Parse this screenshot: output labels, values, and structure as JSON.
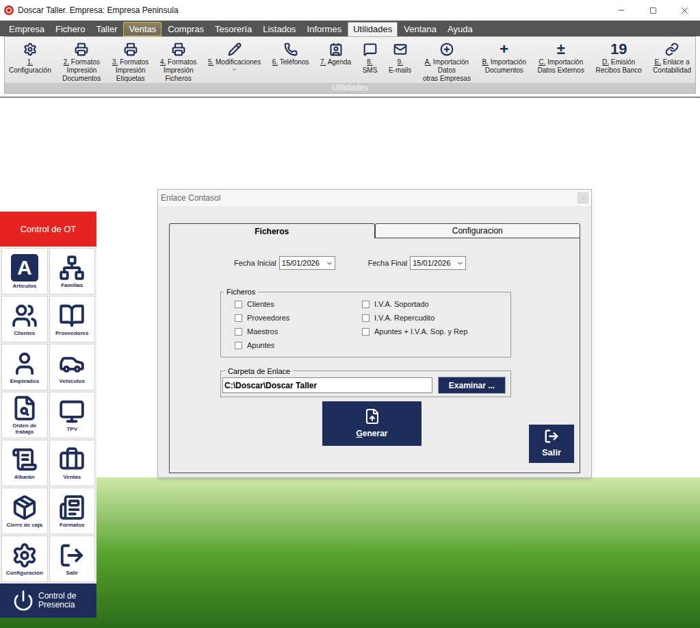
{
  "window": {
    "title": "Doscar Taller. Empresa: Empresa Peninsula"
  },
  "menu": [
    {
      "label": "Empresa",
      "selected": false,
      "highlighted": false
    },
    {
      "label": "Fichero",
      "selected": false,
      "highlighted": false
    },
    {
      "label": "Taller",
      "selected": false,
      "highlighted": false
    },
    {
      "label": "Ventas",
      "selected": false,
      "highlighted": true
    },
    {
      "label": "Compras",
      "selected": false,
      "highlighted": false
    },
    {
      "label": "Tesorería",
      "selected": false,
      "highlighted": false
    },
    {
      "label": "Listados",
      "selected": false,
      "highlighted": false
    },
    {
      "label": "Informes",
      "selected": false,
      "highlighted": false
    },
    {
      "label": "Utilidades",
      "selected": true,
      "highlighted": false
    },
    {
      "label": "Ventana",
      "selected": false,
      "highlighted": false
    },
    {
      "label": "Ayuda",
      "selected": false,
      "highlighted": false
    }
  ],
  "ribbon": {
    "group_label": "Utilidades",
    "buttons": [
      {
        "label": "1.\nConfiguración",
        "kind": "icon",
        "dropdown": false
      },
      {
        "label": "2. Formatos\nImpresión\nDocumentos",
        "kind": "icon",
        "dropdown": false
      },
      {
        "label": "3. Formatos\nImpresión\nEtiquetas",
        "kind": "icon",
        "dropdown": false
      },
      {
        "label": "4. Formatos\nImpresión\nFicheros",
        "kind": "icon",
        "dropdown": false
      },
      {
        "label": "5. Modificaciones",
        "kind": "icon",
        "dropdown": true
      },
      {
        "label": "6. Teléfonos",
        "kind": "icon",
        "dropdown": false
      },
      {
        "label": "7. Agenda",
        "kind": "icon",
        "dropdown": false
      },
      {
        "label": "8.\nSMS",
        "kind": "icon",
        "dropdown": false
      },
      {
        "label": "9.\nE-mails",
        "kind": "icon",
        "dropdown": false
      },
      {
        "label": "A. Importación\nDatos\notras Empresas",
        "kind": "icon",
        "dropdown": false
      },
      {
        "label": "B. Importación\nDocumentos",
        "kind": "glyph",
        "glyph": "+",
        "dropdown": false
      },
      {
        "label": "C. Importación\nDatos Externos",
        "kind": "glyph",
        "glyph": "±",
        "dropdown": false
      },
      {
        "label": "D. Emisión\nRecibos Banco",
        "kind": "glyph",
        "glyph": "19",
        "dropdown": false
      },
      {
        "label": "E. Enlace a\nContabilidad",
        "kind": "icon",
        "dropdown": false
      }
    ]
  },
  "sidebar": {
    "header": "Control de OT",
    "items": [
      {
        "label": "Artículos",
        "kind": "glyph",
        "glyph": "A"
      },
      {
        "label": "Familias",
        "kind": "icon"
      },
      {
        "label": "Clientes",
        "kind": "icon"
      },
      {
        "label": "Proveedores",
        "kind": "icon"
      },
      {
        "label": "Empleados",
        "kind": "icon"
      },
      {
        "label": "Vehículos",
        "kind": "icon"
      },
      {
        "label": "Orden de trabajo",
        "kind": "icon"
      },
      {
        "label": "TPV",
        "kind": "icon"
      },
      {
        "label": "Albarán",
        "kind": "icon"
      },
      {
        "label": "Ventas",
        "kind": "icon"
      },
      {
        "label": "Cierre de caja",
        "kind": "icon"
      },
      {
        "label": "Formatos",
        "kind": "icon"
      },
      {
        "label": "Configuración",
        "kind": "icon"
      },
      {
        "label": "Salir",
        "kind": "icon"
      }
    ],
    "footer": "Control de\nPresencia"
  },
  "dialog": {
    "title": "Enlace Contasol",
    "tabs": [
      {
        "label": "Ficheros",
        "selected": true
      },
      {
        "label": "Configuracion",
        "selected": false
      }
    ],
    "dates": [
      {
        "label": "Fecha Inicial",
        "value": "15/01/2026"
      },
      {
        "label": "Fecha Final",
        "value": "15/01/2026"
      }
    ],
    "files": {
      "legend": "Ficheros",
      "columns": [
        [
          {
            "label": "Clientes",
            "checked": false
          },
          {
            "label": "Proveedores",
            "checked": false
          },
          {
            "label": "Maestros",
            "checked": false
          },
          {
            "label": "Apuntes",
            "checked": false
          }
        ],
        [
          {
            "label": "I.V.A. Soportado",
            "checked": false
          },
          {
            "label": "I.V.A. Repercudito",
            "checked": false
          },
          {
            "label": "Apuntes + I.V.A. Sop. y Rep",
            "checked": false
          }
        ]
      ]
    },
    "folder": {
      "legend": "Carpeta de Enlace",
      "value": "C:\\Doscar\\Doscar Taller",
      "browse": "Examinar ..."
    },
    "generate": "Generar",
    "exit": "Salir"
  }
}
